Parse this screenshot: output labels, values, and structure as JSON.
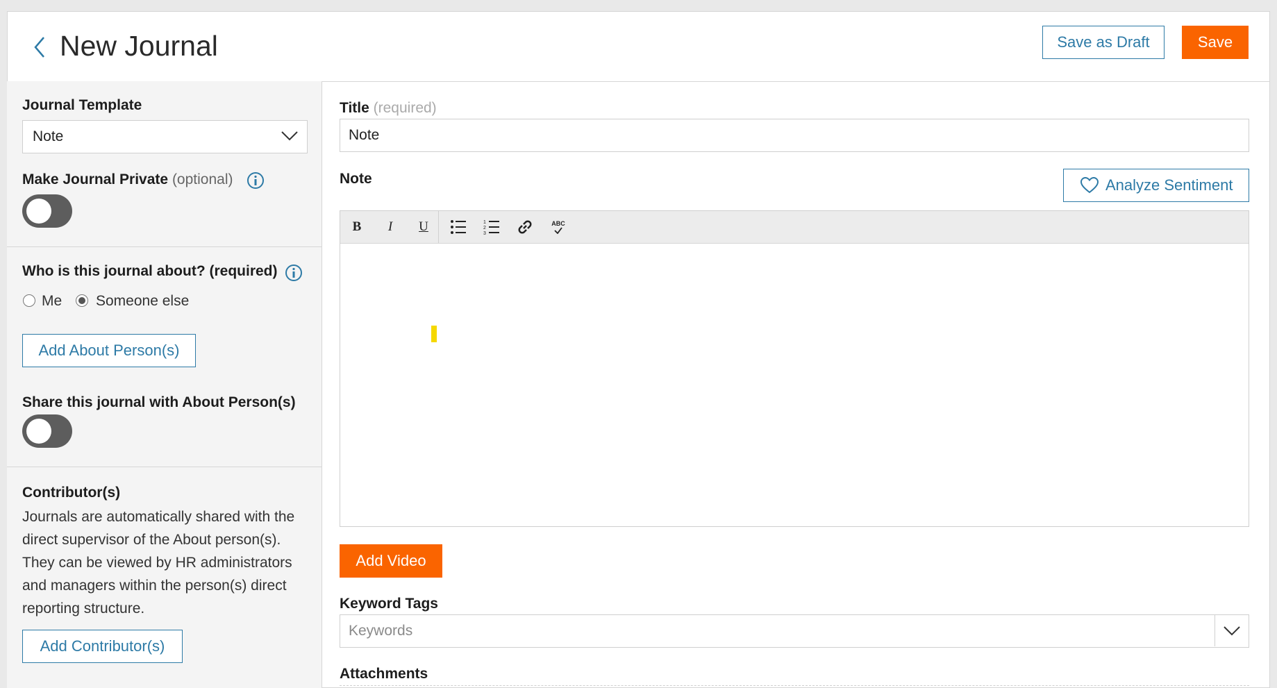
{
  "header": {
    "title": "New Journal",
    "save_draft_label": "Save as Draft",
    "save_label": "Save"
  },
  "sidebar": {
    "template_label": "Journal Template",
    "template_value": "Note",
    "private_label": "Make Journal Private",
    "private_optional": "(optional)",
    "private_on": false,
    "about_label": "Who is this journal about? (required)",
    "about_options": [
      "Me",
      "Someone else"
    ],
    "about_selected": "Someone else",
    "add_about_label": "Add About Person(s)",
    "share_label": "Share this journal with About Person(s)",
    "share_on": false,
    "contributors_label": "Contributor(s)",
    "contributors_text": "Journals are automatically shared with the direct supervisor of the About person(s). They can be viewed by HR administrators and managers within the person(s) direct reporting structure.",
    "add_contributor_label": "Add Contributor(s)"
  },
  "main": {
    "title_label": "Title",
    "title_required": "(required)",
    "title_value": "Note",
    "note_label": "Note",
    "analyze_label": "Analyze Sentiment",
    "toolbar": {
      "bold": "B",
      "italic": "I",
      "underline": "U",
      "spellcheck": "ABC"
    },
    "add_video_label": "Add Video",
    "keyword_label": "Keyword Tags",
    "keyword_placeholder": "Keywords",
    "attachments_label": "Attachments"
  },
  "colors": {
    "accent": "#2d7aa6",
    "primary_button": "#fa6400",
    "toggle_off": "#5d5d5d",
    "cursor_highlight": "#f5d800"
  }
}
